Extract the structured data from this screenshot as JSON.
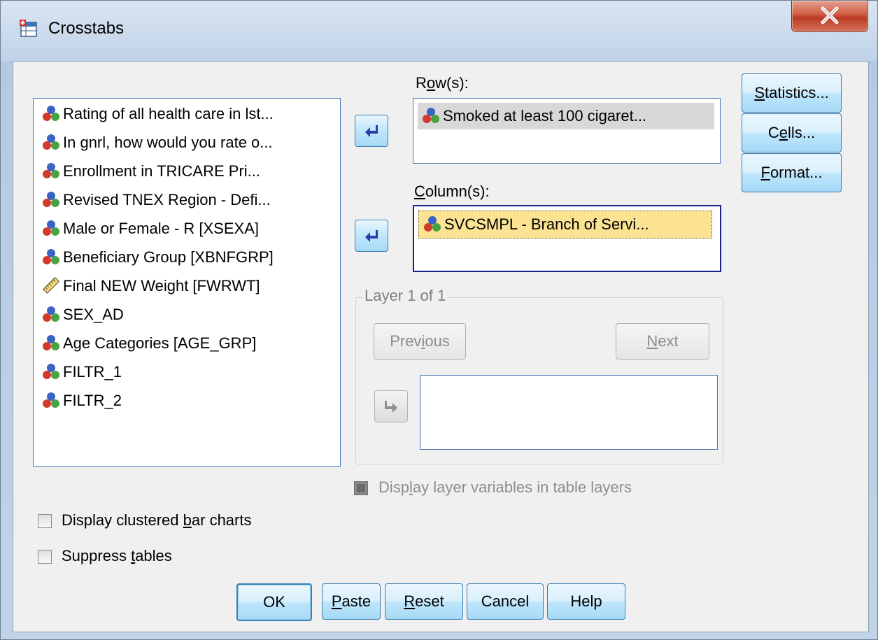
{
  "window": {
    "title": "Crosstabs",
    "close_label": "X"
  },
  "source_variables": [
    {
      "label": "Rating of all health care in lst...",
      "icon": "nominal-icon"
    },
    {
      "label": "In gnrl, how would you rate o...",
      "icon": "nominal-icon"
    },
    {
      "label": "Enrollment in TRICARE Pri...",
      "icon": "nominal-icon"
    },
    {
      "label": "Revised TNEX Region - Defi...",
      "icon": "nominal-icon"
    },
    {
      "label": "Male or Female  - R [XSEXA]",
      "icon": "nominal-icon"
    },
    {
      "label": "Beneficiary Group [XBNFGRP]",
      "icon": "nominal-icon"
    },
    {
      "label": "Final NEW Weight [FWRWT]",
      "icon": "scale-icon"
    },
    {
      "label": "SEX_AD",
      "icon": "nominal-icon"
    },
    {
      "label": "Age Categories [AGE_GRP]",
      "icon": "nominal-icon"
    },
    {
      "label": "FILTR_1",
      "icon": "nominal-icon"
    },
    {
      "label": "FILTR_2",
      "icon": "nominal-icon"
    }
  ],
  "rows": {
    "label_pre": "R",
    "label_mnemonic": "o",
    "label_post": "w(s):",
    "items": [
      "Smoked at least 100 cigaret..."
    ]
  },
  "columns": {
    "label_pre": "",
    "label_mnemonic": "C",
    "label_post": "olumn(s):",
    "items": [
      "SVCSMPL - Branch of Servi..."
    ]
  },
  "layer": {
    "title": "Layer 1 of 1",
    "previous_pre": "Prev",
    "previous_mnemonic": "i",
    "previous_post": "ous",
    "next_pre": "",
    "next_mnemonic": "N",
    "next_post": "ext",
    "display_pre": "Disp",
    "display_mnemonic": "l",
    "display_post": "ay layer variables in table layers"
  },
  "side_buttons": {
    "statistics_pre": "",
    "statistics_mnemonic": "S",
    "statistics_post": "tatistics...",
    "cells_pre": "C",
    "cells_mnemonic": "e",
    "cells_post": "lls...",
    "format_pre": "",
    "format_mnemonic": "F",
    "format_post": "ormat..."
  },
  "options": {
    "clustered_pre": "Display clustered ",
    "clustered_mnemonic": "b",
    "clustered_post": "ar charts",
    "suppress_pre": "Suppress ",
    "suppress_mnemonic": "t",
    "suppress_post": "ables"
  },
  "footer": {
    "ok": "OK",
    "paste_mnemonic": "P",
    "paste_post": "aste",
    "reset_mnemonic": "R",
    "reset_post": "eset",
    "cancel": "Cancel",
    "help": "Help"
  },
  "colors": {
    "button_blue": "#a7d9f5",
    "selection_yellow": "#fbe392",
    "focus_border": "#1b1f8a"
  }
}
